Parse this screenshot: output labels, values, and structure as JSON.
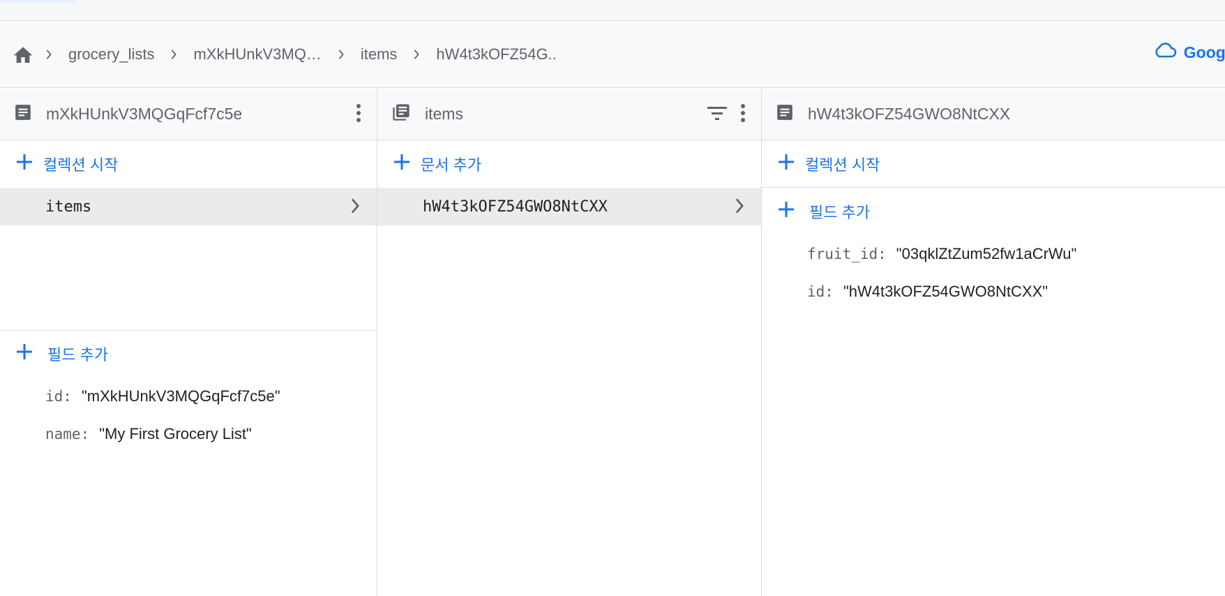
{
  "breadcrumb": {
    "items": [
      "grocery_lists",
      "mXkHUnkV3MQ…",
      "items",
      "hW4t3kOFZ54G.."
    ],
    "right_link": "Google"
  },
  "panel_doc": {
    "title": "mXkHUnkV3MQGqFcf7c5e",
    "start_collection": "컬렉션 시작",
    "subcollections": [
      "items"
    ],
    "add_field": "필드 추가",
    "fields": [
      {
        "key": "id:",
        "value": "\"mXkHUnkV3MQGqFcf7c5e\""
      },
      {
        "key": "name:",
        "value": "\"My First Grocery List\""
      }
    ]
  },
  "panel_collection": {
    "title": "items",
    "add_document": "문서 추가",
    "documents": [
      "hW4t3kOFZ54GWO8NtCXX"
    ]
  },
  "panel_item": {
    "title": "hW4t3kOFZ54GWO8NtCXX",
    "start_collection": "컬렉션 시작",
    "add_field": "필드 추가",
    "fields": [
      {
        "key": "fruit_id:",
        "value": "\"03qklZtZum52fw1aCrWu\""
      },
      {
        "key": "id:",
        "value": "\"hW4t3kOFZ54GWO8NtCXX\""
      }
    ]
  },
  "colors": {
    "accent": "#1a73e8",
    "muted": "#5f6368",
    "selected_row": "#ebebeb",
    "header_bg": "#f8f9fa"
  }
}
